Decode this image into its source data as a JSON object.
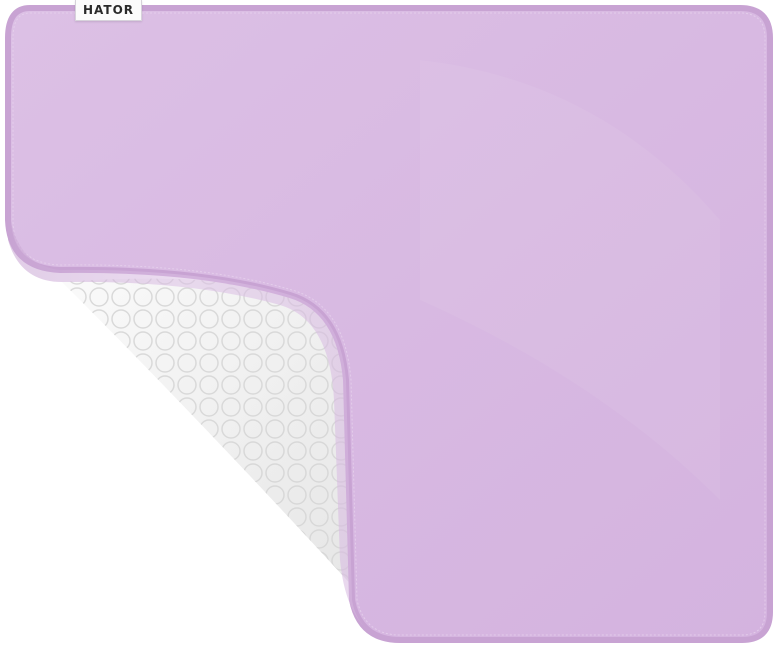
{
  "image": {
    "subject": "mousepad",
    "brand_label": "HATOR",
    "colors": {
      "surface": "#d7b8e1",
      "surface_light": "#e2c8ea",
      "stitching": "#c9a6d4",
      "base": "#f2f2f2",
      "background": "#ffffff"
    }
  }
}
